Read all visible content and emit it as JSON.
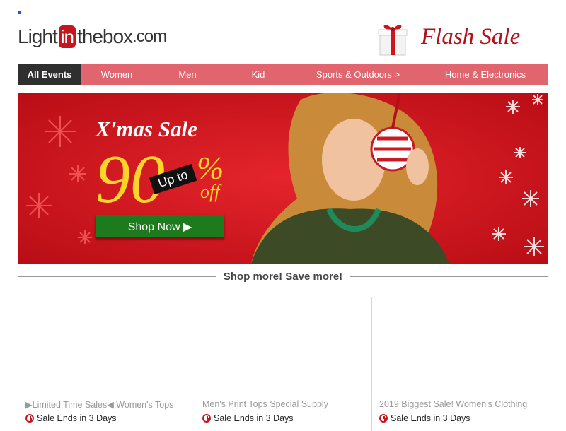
{
  "header": {
    "logo_light": "Light",
    "logo_in": "in",
    "logo_thebox": "thebox",
    "logo_com": ".com",
    "flash_sale": "Flash Sale"
  },
  "nav": {
    "items": [
      {
        "label": "All Events"
      },
      {
        "label": "Women"
      },
      {
        "label": "Men"
      },
      {
        "label": "Kid"
      },
      {
        "label": "Sports & Outdoors >"
      },
      {
        "label": "Home & Electronics"
      }
    ]
  },
  "hero": {
    "title": "X'mas  Sale",
    "big_number": "90",
    "percent": "%",
    "off": "off",
    "up_to": "Up to",
    "shop_now": "Shop Now ▶"
  },
  "section": {
    "heading": "Shop more! Save more!"
  },
  "cards": [
    {
      "title": "▶Limited Time Sales◀ Women's Tops",
      "ends": "Sale Ends in 3 Days"
    },
    {
      "title": "Men's Print Tops Special Supply",
      "ends": "Sale Ends in 3 Days"
    },
    {
      "title": "2019 Biggest Sale! Women's Clothing",
      "ends": "Sale Ends in 3 Days"
    }
  ],
  "colors": {
    "nav_bg": "#e0656f",
    "nav_active": "#2f2f2f",
    "hero_red": "#d3121c",
    "accent_red": "#b1121a",
    "hero_yellow": "#ffd52a",
    "shop_green": "#1d7a1d"
  }
}
